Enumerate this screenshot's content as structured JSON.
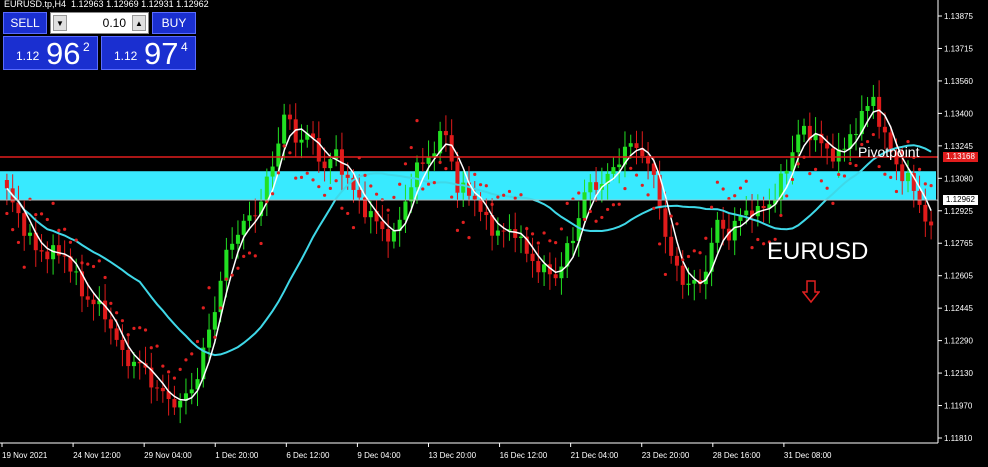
{
  "header": {
    "symbol": "EURUSD.tp,H4",
    "ohlc": "1.12963 1.12969 1.12931 1.12962"
  },
  "trade_panel": {
    "sell_label": "SELL",
    "buy_label": "BUY",
    "lot": "0.10",
    "lot_down_icon": "triangle-down-icon",
    "lot_up_icon": "triangle-up-icon",
    "sell_prefix": "1.12",
    "sell_big": "96",
    "sell_sup": "2",
    "buy_prefix": "1.12",
    "buy_big": "97",
    "buy_sup": "4"
  },
  "annotation": {
    "text": "EURUSD",
    "arrow_icon": "outline-down-arrow-icon",
    "arrow_color": "#e02020"
  },
  "pivot": {
    "label": "Pivotpoint",
    "value": 1.13168,
    "tag": "1.13168",
    "color": "#e11d1d"
  },
  "current_price": {
    "value": 1.12962,
    "tag": "1.12962"
  },
  "zone": {
    "low": 1.1296,
    "high": 1.131,
    "color": "#38eaff"
  },
  "colors": {
    "bull": "#22e022",
    "bear": "#e01b1b",
    "fast_ma": "#ffffff",
    "slow_ma": "#3fd8e8",
    "psar": "#e02020",
    "grid": "#2a2a2a",
    "axis": "#ffffff"
  },
  "chart_data": {
    "type": "candlestick",
    "ylim": [
      1.1181,
      1.1389
    ],
    "y_ticks": [
      "1.13875",
      "1.13715",
      "1.13560",
      "1.13400",
      "1.13245",
      "1.13080",
      "1.12925",
      "1.12765",
      "1.12605",
      "1.12445",
      "1.12290",
      "1.12130",
      "1.11970",
      "1.11810"
    ],
    "x_labels": [
      "19 Nov 2021",
      "24 Nov 12:00",
      "29 Nov 04:00",
      "1 Dec 20:00",
      "6 Dec 12:00",
      "9 Dec 04:00",
      "13 Dec 20:00",
      "16 Dec 12:00",
      "21 Dec 04:00",
      "23 Dec 20:00",
      "28 Dec 16:00",
      "31 Dec 08:00"
    ],
    "close_path": [
      [
        0,
        1.13
      ],
      [
        5,
        1.1272
      ],
      [
        10,
        1.127
      ],
      [
        13,
        1.1252
      ],
      [
        17,
        1.1242
      ],
      [
        20,
        1.1222
      ],
      [
        24,
        1.1215
      ],
      [
        26,
        1.1205
      ],
      [
        30,
        1.1198
      ],
      [
        33,
        1.1212
      ],
      [
        36,
        1.1245
      ],
      [
        38,
        1.127
      ],
      [
        40,
        1.1282
      ],
      [
        43,
        1.129
      ],
      [
        46,
        1.1312
      ],
      [
        48,
        1.1338
      ],
      [
        50,
        1.1325
      ],
      [
        52,
        1.1328
      ],
      [
        55,
        1.1312
      ],
      [
        57,
        1.1318
      ],
      [
        60,
        1.13
      ],
      [
        62,
        1.1292
      ],
      [
        65,
        1.1282
      ],
      [
        67,
        1.1278
      ],
      [
        70,
        1.1305
      ],
      [
        72,
        1.1315
      ],
      [
        74,
        1.132
      ],
      [
        76,
        1.133
      ],
      [
        78,
        1.13
      ],
      [
        80,
        1.1302
      ],
      [
        82,
        1.129
      ],
      [
        85,
        1.128
      ],
      [
        88,
        1.1282
      ],
      [
        90,
        1.127
      ],
      [
        93,
        1.1262
      ],
      [
        95,
        1.126
      ],
      [
        98,
        1.1278
      ],
      [
        100,
        1.13
      ],
      [
        103,
        1.1305
      ],
      [
        105,
        1.131
      ],
      [
        107,
        1.1322
      ],
      [
        110,
        1.132
      ],
      [
        112,
        1.1306
      ],
      [
        115,
        1.1268
      ],
      [
        117,
        1.1258
      ],
      [
        120,
        1.1255
      ],
      [
        123,
        1.1285
      ],
      [
        125,
        1.128
      ],
      [
        128,
        1.1292
      ],
      [
        130,
        1.129
      ],
      [
        133,
        1.1298
      ],
      [
        135,
        1.1312
      ],
      [
        137,
        1.1328
      ],
      [
        140,
        1.1328
      ],
      [
        142,
        1.1318
      ],
      [
        145,
        1.132
      ],
      [
        147,
        1.1332
      ],
      [
        150,
        1.1345
      ],
      [
        152,
        1.1325
      ],
      [
        155,
        1.1308
      ],
      [
        157,
        1.1302
      ],
      [
        160,
        1.128
      ]
    ]
  }
}
